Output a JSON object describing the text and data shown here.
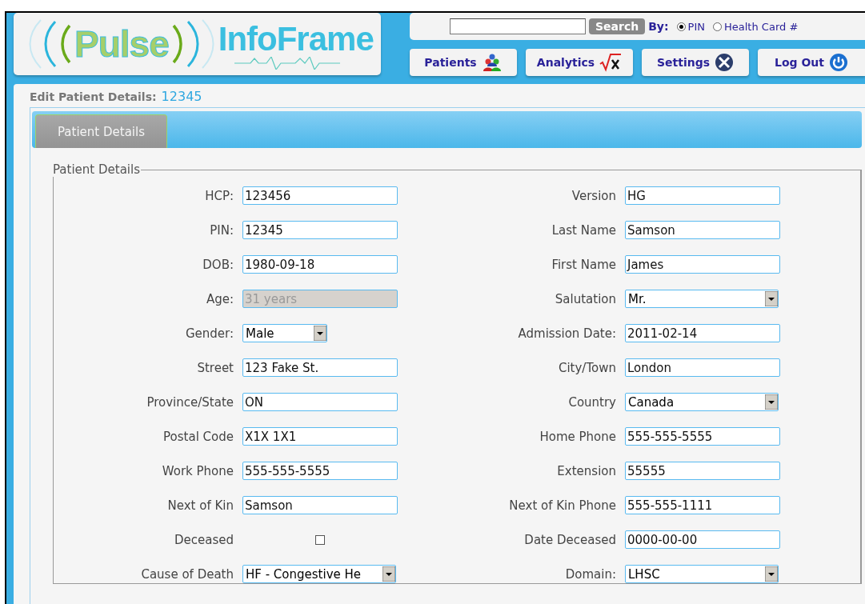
{
  "logo": {
    "first": "Pulse",
    "second": "InfoFrame"
  },
  "search": {
    "button": "Search",
    "by_label": "By:",
    "options": [
      {
        "label": "PIN",
        "selected": true
      },
      {
        "label": "Health Card #",
        "selected": false
      }
    ]
  },
  "nav": [
    {
      "label": "Patients"
    },
    {
      "label": "Analytics"
    },
    {
      "label": "Settings"
    },
    {
      "label": "Log Out"
    }
  ],
  "heading": {
    "label": "Edit Patient Details:",
    "id": "12345"
  },
  "tabs": [
    {
      "label": "Patient Details",
      "selected": true
    }
  ],
  "fieldset": {
    "legend": "Patient Details"
  },
  "rows": [
    {
      "left": {
        "label": "HCP:",
        "kind": "text",
        "value": "123456"
      },
      "right": {
        "label": "Version",
        "kind": "text",
        "value": "HG"
      }
    },
    {
      "left": {
        "label": "PIN:",
        "kind": "text",
        "value": "12345"
      },
      "right": {
        "label": "Last Name",
        "kind": "text",
        "value": "Samson"
      }
    },
    {
      "left": {
        "label": "DOB:",
        "kind": "text",
        "value": "1980-09-18"
      },
      "right": {
        "label": "First Name",
        "kind": "text",
        "value": "James"
      }
    },
    {
      "left": {
        "label": "Age:",
        "kind": "text",
        "value": "31 years",
        "disabled": true
      },
      "right": {
        "label": "Salutation",
        "kind": "select",
        "value": "Mr."
      }
    },
    {
      "left": {
        "label": "Gender:",
        "kind": "compact",
        "value": "Male"
      },
      "right": {
        "label": "Admission Date:",
        "kind": "text",
        "value": "2011-02-14"
      }
    },
    {
      "left": {
        "label": "Street",
        "kind": "text",
        "value": "123 Fake St."
      },
      "right": {
        "label": "City/Town",
        "kind": "text",
        "value": "London"
      }
    },
    {
      "left": {
        "label": "Province/State",
        "kind": "text",
        "value": "ON"
      },
      "right": {
        "label": "Country",
        "kind": "select",
        "value": "Canada"
      }
    },
    {
      "left": {
        "label": "Postal Code",
        "kind": "text",
        "value": "X1X 1X1"
      },
      "right": {
        "label": "Home Phone",
        "kind": "text",
        "value": "555-555-5555"
      }
    },
    {
      "left": {
        "label": "Work Phone",
        "kind": "text",
        "value": "555-555-5555"
      },
      "right": {
        "label": "Extension",
        "kind": "text",
        "value": "55555"
      }
    },
    {
      "left": {
        "label": "Next of Kin",
        "kind": "text",
        "value": "Samson"
      },
      "right": {
        "label": "Next of Kin Phone",
        "kind": "text",
        "value": "555-555-1111"
      }
    },
    {
      "left": {
        "label": "Deceased",
        "kind": "checkbox",
        "checked": false
      },
      "right": {
        "label": "Date Deceased",
        "kind": "text",
        "value": "0000-00-00"
      }
    },
    {
      "left": {
        "label": "Cause of Death",
        "kind": "select",
        "value": "HF - Congestive He"
      },
      "right": {
        "label": "Domain:",
        "kind": "select",
        "value": "LHSC"
      }
    }
  ]
}
